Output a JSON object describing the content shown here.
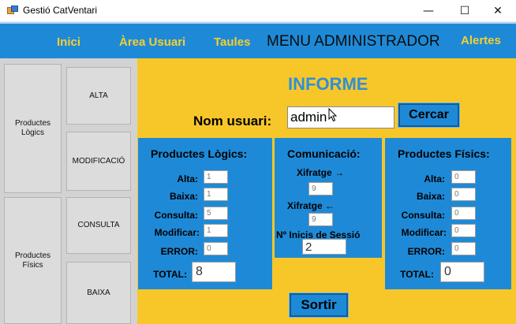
{
  "window": {
    "title": "Gestió CatVentari",
    "controls": {
      "minimize": "—",
      "maximize": "☐",
      "close": "✕"
    }
  },
  "menubar": {
    "inici": "Inici",
    "area_usuari": "Àrea Usuari",
    "taules": "Taules",
    "title": "MENU ADMINISTRADOR",
    "alertes": "Alertes"
  },
  "sidebar": {
    "productes_logics_line1": "Productes",
    "productes_logics_line2": "Lògics",
    "productes_fisics_line1": "Productes",
    "productes_fisics_line2": "Físics",
    "alta": "ALTA",
    "modificacio": "MODIFICACIÓ",
    "consulta": "CONSULTA",
    "baixa": "BAIXA"
  },
  "informe": {
    "title": "INFORME",
    "nom_usuari_label": "Nom usuari:",
    "nom_usuari_value": "admin",
    "cercar_label": "Cercar",
    "sortir_label": "Sortir"
  },
  "productes_logics": {
    "title": "Productes Lògics:",
    "labels": {
      "alta": "Alta:",
      "baixa": "Baixa:",
      "consulta": "Consulta:",
      "modificar": "Modificar:",
      "error": "ERROR:",
      "total": "TOTAL:"
    },
    "values": {
      "alta": "1",
      "baixa": "1",
      "consulta": "5",
      "modificar": "1",
      "error": "0",
      "total": "8"
    }
  },
  "comunicacio": {
    "title": "Comunicació:",
    "xifratge_right_label": "Xifratge →",
    "xifratge_right_value": "9",
    "xifratge_left_label": "Xifratge ←",
    "xifratge_left_value": "9",
    "inicis_label": "Nº Inicis de Sessió",
    "inicis_value": "2"
  },
  "productes_fisics": {
    "title": "Productes Físics:",
    "labels": {
      "alta": "Alta:",
      "baixa": "Baixa:",
      "consulta": "Consulta:",
      "modificar": "Modificar:",
      "error": "ERROR:",
      "total": "TOTAL:"
    },
    "values": {
      "alta": "0",
      "baixa": "0",
      "consulta": "0",
      "modificar": "0",
      "error": "0",
      "total": "0"
    }
  },
  "colors": {
    "menubar": "#1e8ad7",
    "accent_yellow": "#f7c72a",
    "menu_text": "#f5cf30",
    "informe_title": "#2f8fd8"
  }
}
